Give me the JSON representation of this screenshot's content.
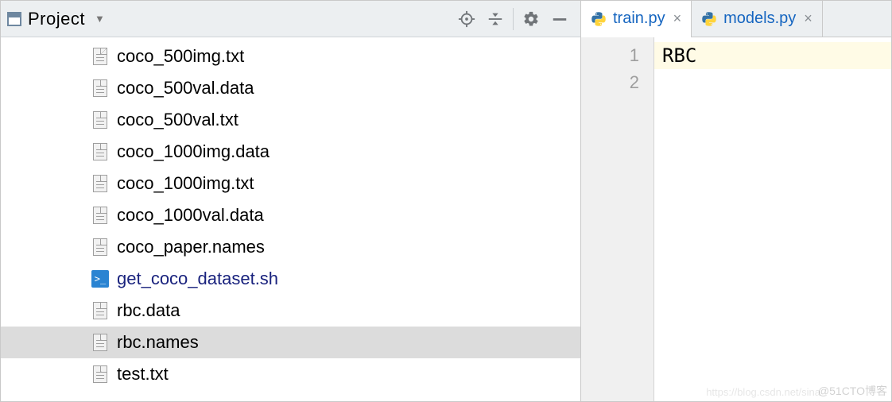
{
  "project_panel": {
    "title": "Project",
    "toolbar": {
      "target_tooltip": "Select Opened File",
      "collapse_tooltip": "Collapse All",
      "settings_tooltip": "Settings",
      "hide_tooltip": "Hide"
    },
    "items": [
      {
        "name": "coco_500img.txt",
        "kind": "file"
      },
      {
        "name": "coco_500val.data",
        "kind": "file"
      },
      {
        "name": "coco_500val.txt",
        "kind": "file"
      },
      {
        "name": "coco_1000img.data",
        "kind": "file"
      },
      {
        "name": "coco_1000img.txt",
        "kind": "file"
      },
      {
        "name": "coco_1000val.data",
        "kind": "file"
      },
      {
        "name": "coco_paper.names",
        "kind": "file"
      },
      {
        "name": "get_coco_dataset.sh",
        "kind": "sh"
      },
      {
        "name": "rbc.data",
        "kind": "file"
      },
      {
        "name": "rbc.names",
        "kind": "file",
        "selected": true
      },
      {
        "name": "test.txt",
        "kind": "file"
      }
    ]
  },
  "editor": {
    "tabs": [
      {
        "label": "train.py",
        "active": true
      },
      {
        "label": "models.py",
        "active": false
      }
    ],
    "gutter_lines": [
      "1",
      "2"
    ],
    "lines": [
      {
        "text": "RBC",
        "current": true
      },
      {
        "text": "",
        "current": false
      }
    ]
  },
  "watermark": "@51CTO博客",
  "watermark_faint": "https://blog.csdn.net/sina"
}
